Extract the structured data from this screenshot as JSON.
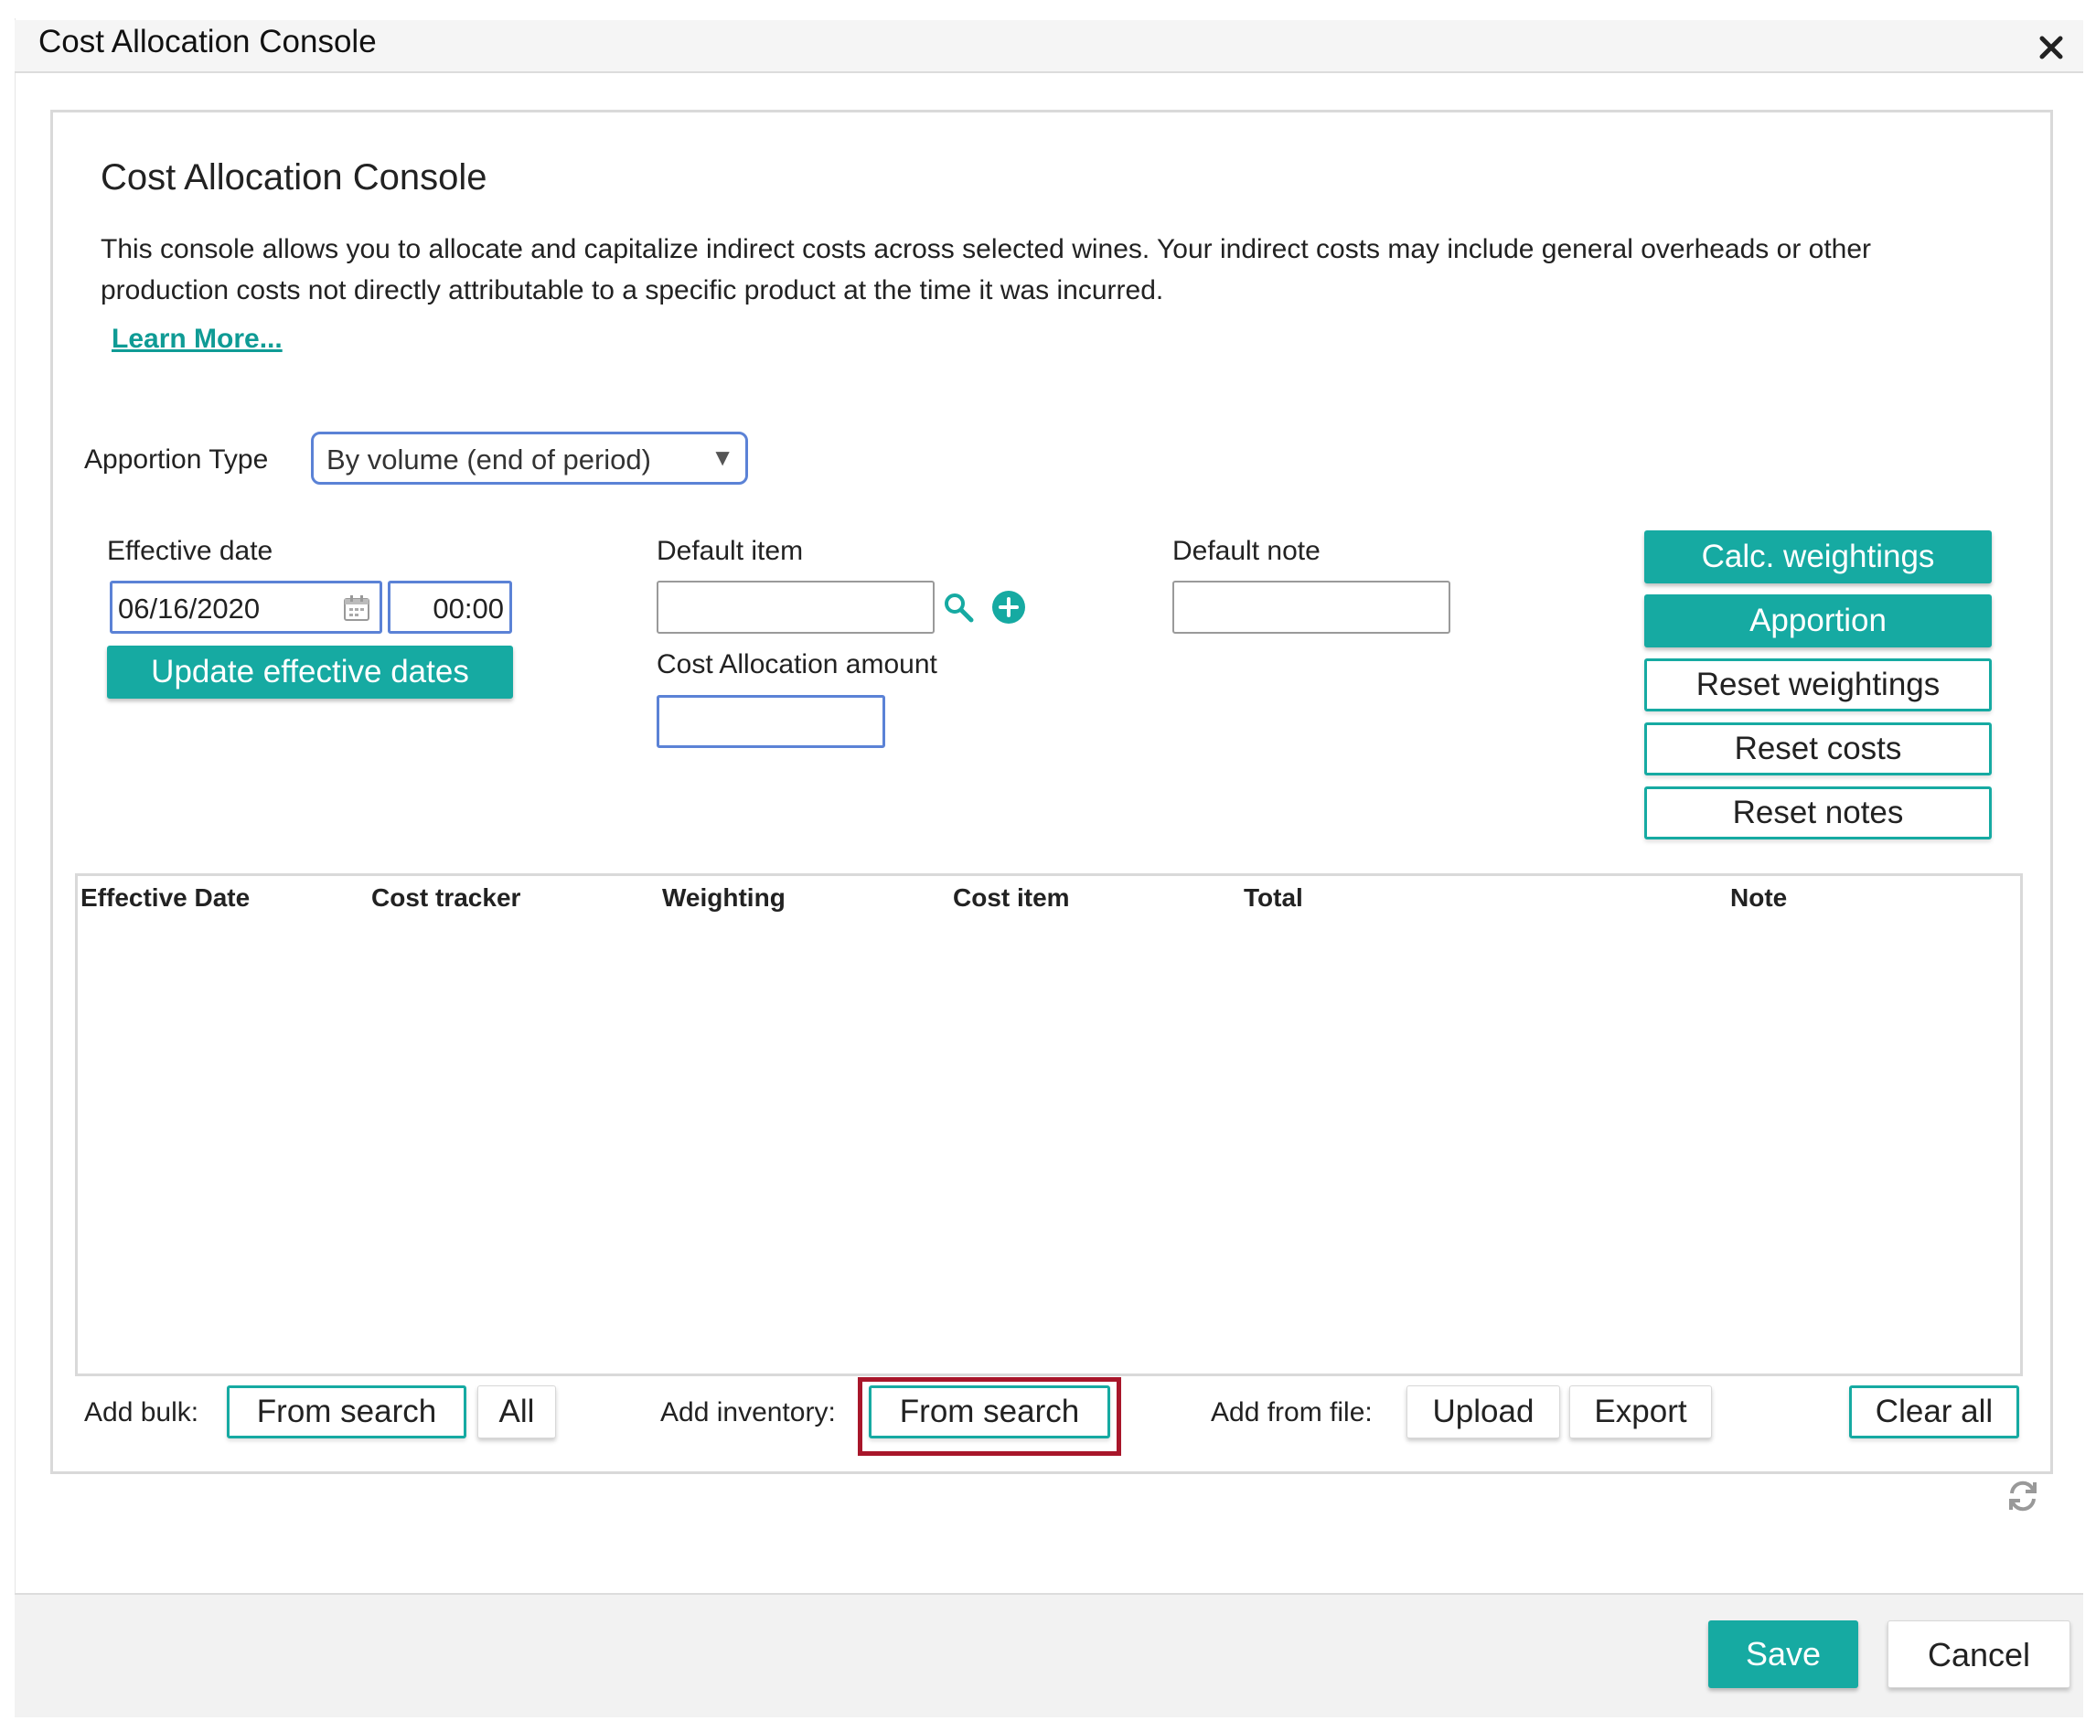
{
  "window": {
    "title": "Cost Allocation Console"
  },
  "console": {
    "heading": "Cost Allocation Console",
    "description": "This console allows you to allocate and capitalize indirect costs across selected wines. Your indirect costs may include general overheads or other production costs not directly attributable to a specific product at the time it was incurred.",
    "learn_more": "Learn More..."
  },
  "apportion": {
    "label": "Apportion Type",
    "selected": "By volume (end of period)"
  },
  "effective": {
    "label": "Effective date",
    "date": "06/16/2020",
    "time": "00:00",
    "update_button": "Update effective dates"
  },
  "default_item": {
    "label": "Default item",
    "value": ""
  },
  "cost_amount": {
    "label": "Cost Allocation amount",
    "value": ""
  },
  "default_note": {
    "label": "Default note",
    "value": ""
  },
  "actions": {
    "calc_weightings": "Calc. weightings",
    "apportion": "Apportion",
    "reset_weightings": "Reset weightings",
    "reset_costs": "Reset costs",
    "reset_notes": "Reset notes"
  },
  "table": {
    "columns": [
      "Effective Date",
      "Cost tracker",
      "Weighting",
      "Cost item",
      "Total",
      "Note"
    ],
    "rows": []
  },
  "bottom_bar": {
    "add_bulk_label": "Add bulk:",
    "bulk_from_search": "From search",
    "bulk_all": "All",
    "add_inventory_label": "Add inventory:",
    "inventory_from_search": "From search",
    "add_from_file_label": "Add from file:",
    "upload": "Upload",
    "export": "Export",
    "clear_all": "Clear all"
  },
  "footer": {
    "save": "Save",
    "cancel": "Cancel"
  },
  "colors": {
    "accent": "#16aaa2",
    "highlight": "#a8162a",
    "focus_border": "#5b82d6"
  },
  "icons": [
    "close-icon",
    "calendar-icon",
    "dropdown-arrow-icon",
    "search-icon",
    "add-circle-icon",
    "refresh-icon"
  ]
}
